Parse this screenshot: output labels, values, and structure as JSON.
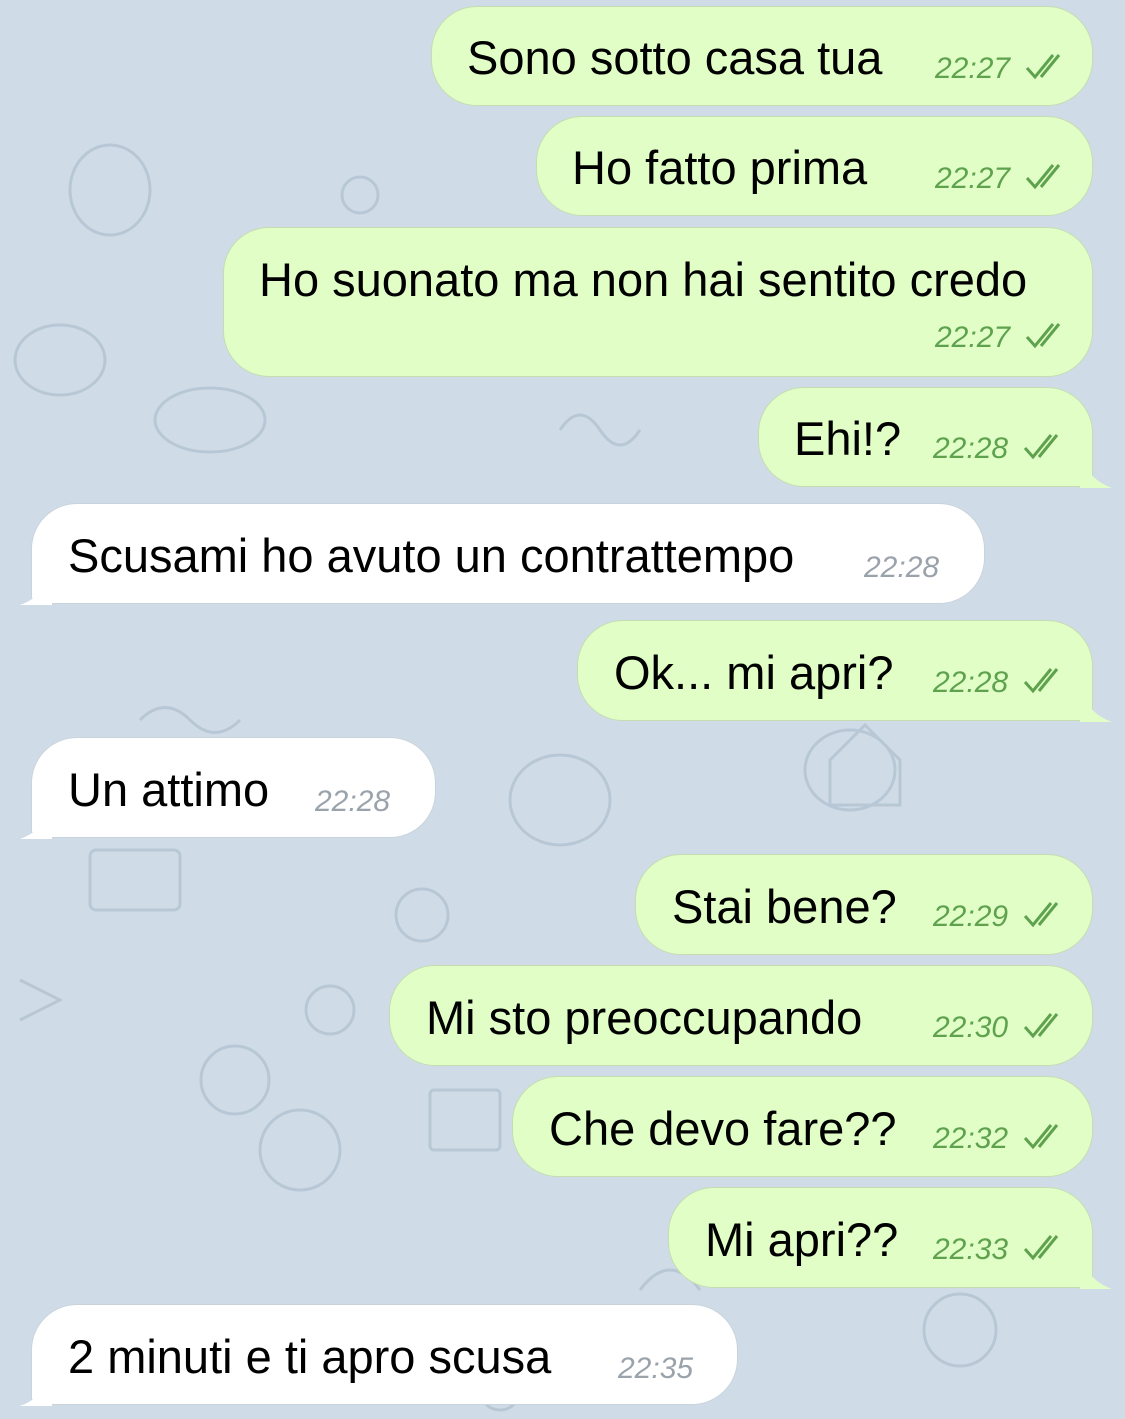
{
  "colors": {
    "background": "#cfdce7",
    "outgoing_bubble": "#e1fec7",
    "incoming_bubble": "#ffffff",
    "outgoing_time": "#5ea24e",
    "incoming_time": "#9aa3ab"
  },
  "messages": [
    {
      "direction": "outgoing",
      "text": "Sono sotto casa tua",
      "time": "22:27",
      "status_icon": "double-check-icon"
    },
    {
      "direction": "outgoing",
      "text": "Ho fatto prima",
      "time": "22:27",
      "status_icon": "double-check-icon"
    },
    {
      "direction": "outgoing",
      "text": "Ho suonato ma non hai sentito credo",
      "time": "22:27",
      "status_icon": "double-check-icon"
    },
    {
      "direction": "outgoing",
      "text": "Ehi!?",
      "time": "22:28",
      "status_icon": "double-check-icon"
    },
    {
      "direction": "incoming",
      "text": "Scusami ho avuto un contrattempo",
      "time": "22:28"
    },
    {
      "direction": "outgoing",
      "text": "Ok... mi apri?",
      "time": "22:28",
      "status_icon": "double-check-icon"
    },
    {
      "direction": "incoming",
      "text": "Un attimo",
      "time": "22:28"
    },
    {
      "direction": "outgoing",
      "text": "Stai bene?",
      "time": "22:29",
      "status_icon": "double-check-icon"
    },
    {
      "direction": "outgoing",
      "text": "Mi sto preoccupando",
      "time": "22:30",
      "status_icon": "double-check-icon"
    },
    {
      "direction": "outgoing",
      "text": "Che devo fare??",
      "time": "22:32",
      "status_icon": "double-check-icon"
    },
    {
      "direction": "outgoing",
      "text": "Mi apri??",
      "time": "22:33",
      "status_icon": "double-check-icon"
    },
    {
      "direction": "incoming",
      "text": "2 minuti e ti apro scusa",
      "time": "22:35"
    }
  ]
}
